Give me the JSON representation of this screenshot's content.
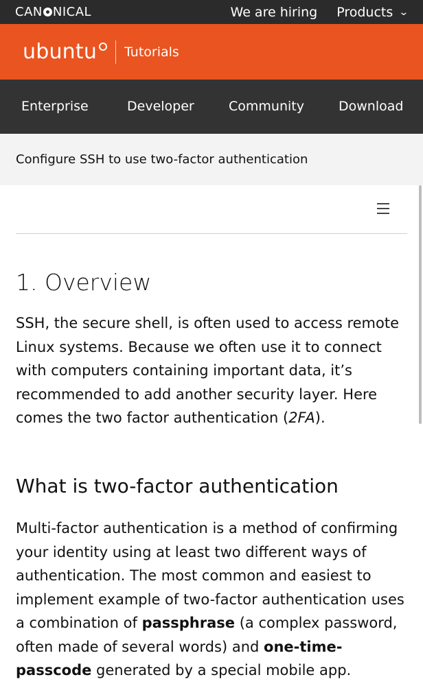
{
  "canonical": {
    "logo_prefix": "CAN",
    "logo_suffix": "NICAL",
    "hiring": "We are hiring",
    "products": "Products"
  },
  "ubuntu": {
    "logo": "ubuntu",
    "section": "Tutorials"
  },
  "nav": {
    "items": [
      "Enterprise",
      "Developer",
      "Community",
      "Download"
    ]
  },
  "page": {
    "title": "Configure SSH to use two-factor authentication"
  },
  "article": {
    "h1": "1. Overview",
    "overview_text_1": "SSH, the secure shell, is often used to access remote Linux systems. Because we often use it to connect with computers containing important data, it’s recommended to add another security layer. Here comes the two factor authentication (",
    "overview_abbr": "2FA",
    "overview_text_2": ").",
    "h2": "What is two-factor authentication",
    "mfa_text_1": "Multi-factor authentication is a method of confirming your identity using at least two different ways of authentication. The most common and easiest to implement example of two-factor authentication uses a combination of ",
    "mfa_bold_1": "passphrase",
    "mfa_text_2": " (a complex password, often made of several words) and ",
    "mfa_bold_2": "one-time-passcode",
    "mfa_text_3": " generated by a special mobile app."
  }
}
